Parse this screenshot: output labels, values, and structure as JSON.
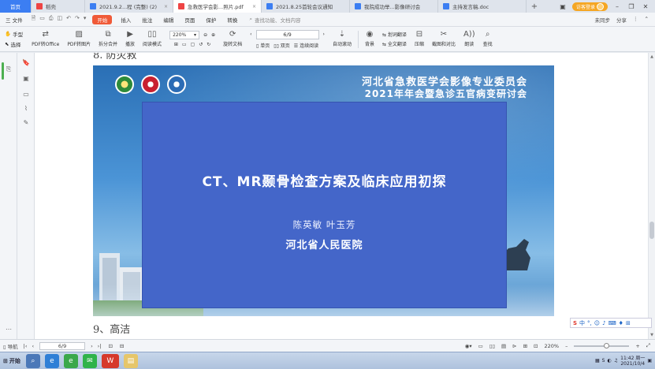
{
  "tabs": [
    {
      "label": "首页",
      "kind": "home"
    },
    {
      "label": "稻壳",
      "color": "#e44"
    },
    {
      "label": "2021.9.2...程 (完整) (2)",
      "color": "#3c7ef2"
    },
    {
      "label": "急救医学会影...照片.pdf",
      "color": "#e44",
      "active": true
    },
    {
      "label": "2021.8.25首轮会议通知",
      "color": "#3c7ef2"
    },
    {
      "label": "我院成功举...影像研讨会",
      "color": "#3c7ef2"
    },
    {
      "label": "主持发言稿.doc",
      "color": "#3c7ef2"
    }
  ],
  "tab_add": "+",
  "login_label": "访客登录",
  "menu": {
    "file": "三 文件",
    "items": [
      "开始",
      "插入",
      "批注",
      "编辑",
      "页面",
      "保护",
      "转换"
    ],
    "active": "开始",
    "search_placeholder": "查找功能、文档内容",
    "right": [
      "未同步",
      "分享"
    ]
  },
  "toolbar": {
    "hand": "手型",
    "select": "选择",
    "pdf_to_office": "PDF转Office",
    "pdf_to_image": "PDF转图片",
    "split_merge": "拆分合并",
    "play": "播放",
    "read_mode": "阅读模式",
    "zoom": "220%",
    "rotate": "旋转文档",
    "page_indicator": "6/9",
    "single": "单页",
    "double": "双页",
    "continuous": "连续阅读",
    "auto_scroll": "自动滚动",
    "background": "背景",
    "translate_word": "划词翻译",
    "translate_full": "全文翻译",
    "compress": "压缩",
    "screenshot": "截图和对比",
    "read_aloud": "朗读",
    "find": "查找"
  },
  "document": {
    "heading_top": "8. 防灾救",
    "heading_bottom": "9、高洁",
    "slide": {
      "title_line1": "河北省急救医学会影像专业委员会",
      "title_line2": "2021年年会暨急诊五官病变研讨会",
      "main_title": "CT、MR颞骨检查方案及临床应用初探",
      "authors": "陈英敏 叶玉芳",
      "hospital": "河北省人民医院"
    }
  },
  "ime": {
    "mode": "中"
  },
  "status": {
    "nav": "导航",
    "page": "6/9",
    "zoom": "220%"
  },
  "taskbar": {
    "start": "开始",
    "time": "11:42 周一",
    "date": "2021/10/4"
  }
}
